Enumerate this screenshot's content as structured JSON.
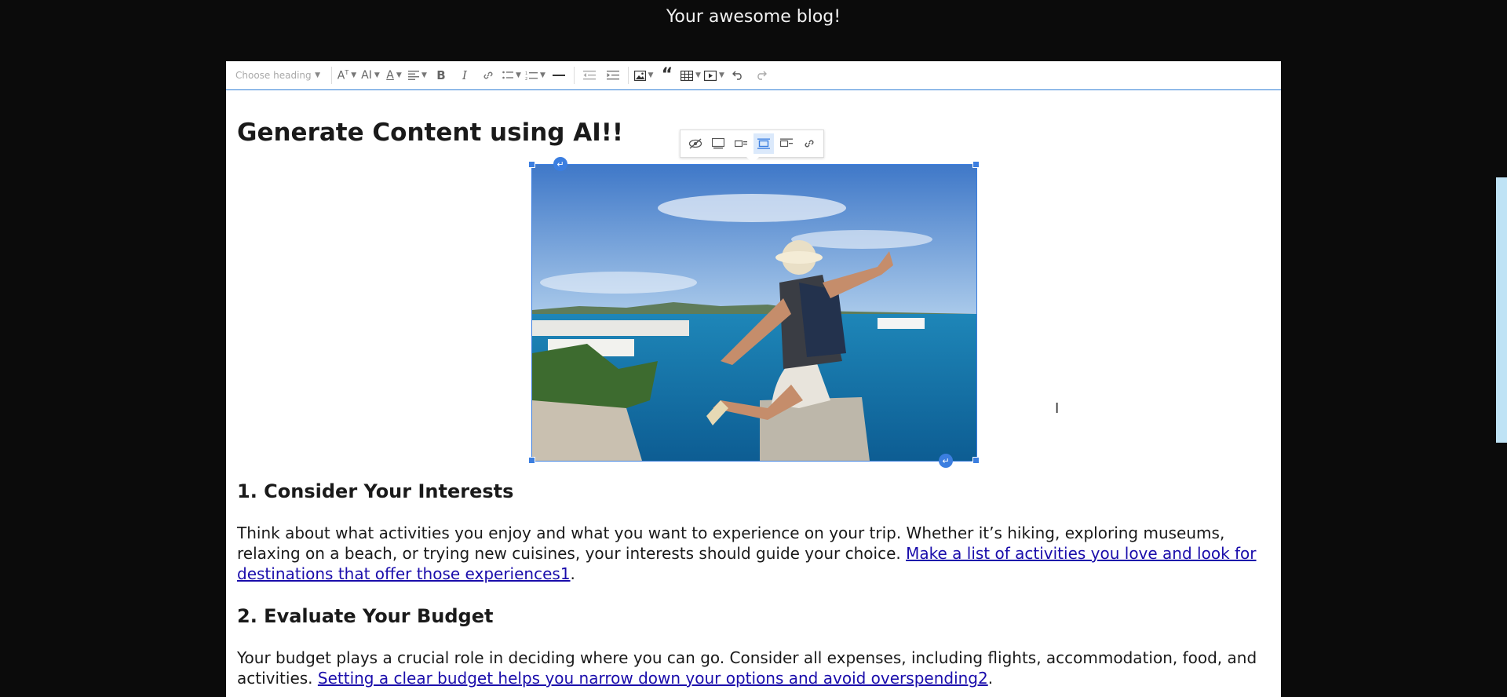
{
  "site": {
    "title": "Your awesome blog!"
  },
  "toolbar": {
    "heading_placeholder": "Choose heading",
    "buttons": [
      "font-size",
      "font-family",
      "font-color",
      "alignment",
      "bold",
      "italic",
      "link",
      "bulleted-list",
      "numbered-list",
      "horizontal-line",
      "outdent",
      "indent",
      "insert-image",
      "block-quote",
      "insert-table",
      "insert-media",
      "undo",
      "redo"
    ],
    "bold_label": "B",
    "italic_label": "I"
  },
  "image_toolbar": {
    "buttons": [
      "toggle-caption-icon",
      "image-full-icon",
      "image-side-icon",
      "image-center-icon",
      "image-inline-icon",
      "image-link-icon"
    ],
    "active": "image-center-icon"
  },
  "content": {
    "title": "Generate Content using AI!!",
    "image": {
      "alt": "Traveler with hat and backpack sitting on a rock wall overlooking a coastal town and turquoise sea"
    },
    "sections": [
      {
        "heading": "1. Consider Your Interests",
        "text": "Think about what activities you enjoy and what you want to experience on your trip. Whether it’s hiking, exploring museums, relaxing on a beach, or trying new cuisines, your interests should guide your choice. ",
        "link": "Make a list of activities you love and look for destinations that offer those experiences1",
        "after": "."
      },
      {
        "heading": "2. Evaluate Your Budget",
        "text": "Your budget plays a crucial role in deciding where you can go. Consider all expenses, including flights, accommodation, food, and activities. ",
        "link": "Setting a clear budget helps you narrow down your options and avoid overspending2",
        "after": "."
      }
    ]
  },
  "colors": {
    "accent": "#3b7ee0",
    "link": "#1a0dab",
    "page_bg": "#0b0b0b"
  }
}
